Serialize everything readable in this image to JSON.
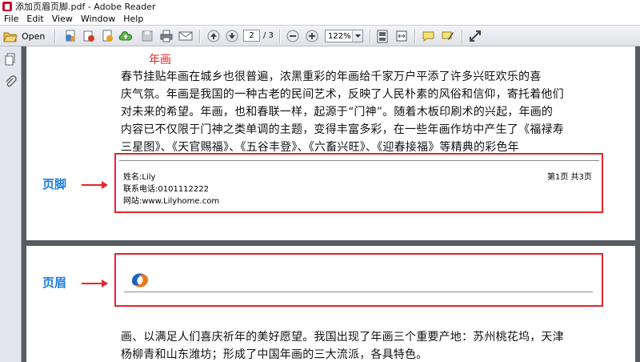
{
  "window": {
    "title": "添加页眉页脚.pdf - Adobe Reader"
  },
  "menu": [
    "File",
    "Edit",
    "View",
    "Window",
    "Help"
  ],
  "toolbar": {
    "open_label": "Open",
    "page_current": "2",
    "page_total": "/ 3",
    "zoom": "122%"
  },
  "page1": {
    "section_title": "年画",
    "lines": [
      "春节挂贴年画在城乡也很普遍，浓黑重彩的年画给千家万户平添了许多兴旺欢乐的喜",
      "庆气氛。年画是我国的一种古老的民间艺术，反映了人民朴素的风俗和信仰，寄托着他们",
      "对未来的希望。年画，也和春联一样，起源于“门神”。随着木板印刷术的兴起，年画的",
      "内容已不仅限于门神之类单调的主题，变得丰富多彩，在一些年画作坊中产生了《福禄寿",
      "三星图》、《天官赐福》、《五谷丰登》、《六畜兴旺》、《迎春接福》等精典的彩色年"
    ],
    "footer": {
      "name": "姓名:Lily",
      "phone": "联系电话:0101112222",
      "website": "网站:www.Lilyhome.com",
      "page_info": "第1页 共3页"
    },
    "annotation_label": "页脚"
  },
  "page2": {
    "annotation_label": "页眉",
    "lines": [
      "画、以满足人们喜庆祈年的美好愿望。我国出现了年画三个重要产地：苏州桃花坞，天津",
      "杨柳青和山东潍坊；形成了中国年画的三大流派，各具特色。"
    ]
  },
  "colors": {
    "annotation_box": "#e3262d",
    "annotation_label": "#1e7fe0",
    "section_title": "#e0272b"
  }
}
